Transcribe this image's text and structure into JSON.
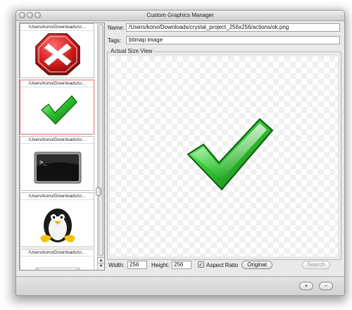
{
  "window": {
    "title": "Custom Graphics Manager"
  },
  "thumbnails": [
    {
      "path": "/Users/kono/Downloads/cr...",
      "icon": "cancel-icon"
    },
    {
      "path": "/Users/kono/Downloads/cr...",
      "icon": "check-icon",
      "selected": true
    },
    {
      "path": "/Users/kono/Downloads/cr...",
      "icon": "terminal-icon"
    },
    {
      "path": "/Users/kono/Downloads/cr...",
      "icon": "penguin-icon"
    },
    {
      "path": "/Users/kono/Downloads/cr...",
      "icon": "mail-icon"
    }
  ],
  "details": {
    "name_label": "Name:",
    "name_value": "/Users/kono/Downloads/crystal_project_256x256/actions/ok.png",
    "tags_label": "Tags:",
    "tags_value": "bitmap image"
  },
  "preview": {
    "legend": "Actual Size View",
    "icon": "check-icon"
  },
  "size": {
    "width_label": "Width:",
    "width_value": "256",
    "height_label": "Height:",
    "height_value": "256",
    "aspect_label": "Aspect Ratio",
    "aspect_checked": true,
    "original_label": "Original",
    "search_label": "Search"
  },
  "footer": {
    "add_label": "+",
    "remove_label": "−"
  },
  "colors": {
    "accent_selected": "#e26b6b",
    "check_green": "#2fc42f",
    "cancel_red": "#d92020"
  }
}
